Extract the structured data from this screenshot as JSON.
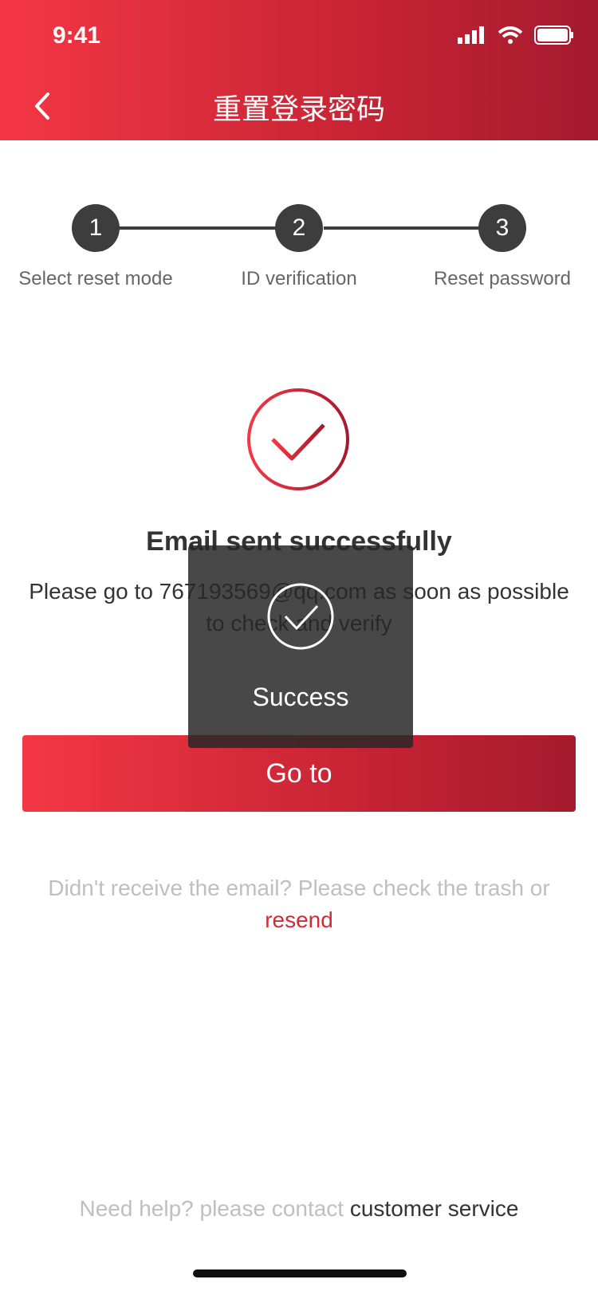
{
  "status": {
    "time": "9:41"
  },
  "header": {
    "title": "重置登录密码"
  },
  "stepper": {
    "steps": [
      {
        "number": "1",
        "label": "Select reset mode"
      },
      {
        "number": "2",
        "label": "ID verification"
      },
      {
        "number": "3",
        "label": "Reset password"
      }
    ]
  },
  "result": {
    "title": "Email sent successfully",
    "message_line1": "Please go to 767193569@qq.com as soon as possible",
    "message_line2": "to check and verify"
  },
  "actions": {
    "goto_label": "Go to"
  },
  "receive": {
    "text": "Didn't receive the email? Please check the trash or",
    "resend_label": "resend"
  },
  "help": {
    "text": "Need help? please contact ",
    "link_label": "customer service"
  },
  "toast": {
    "label": "Success"
  },
  "colors": {
    "brand_red": "#d22a36",
    "step_dark": "#3d3d3d"
  }
}
